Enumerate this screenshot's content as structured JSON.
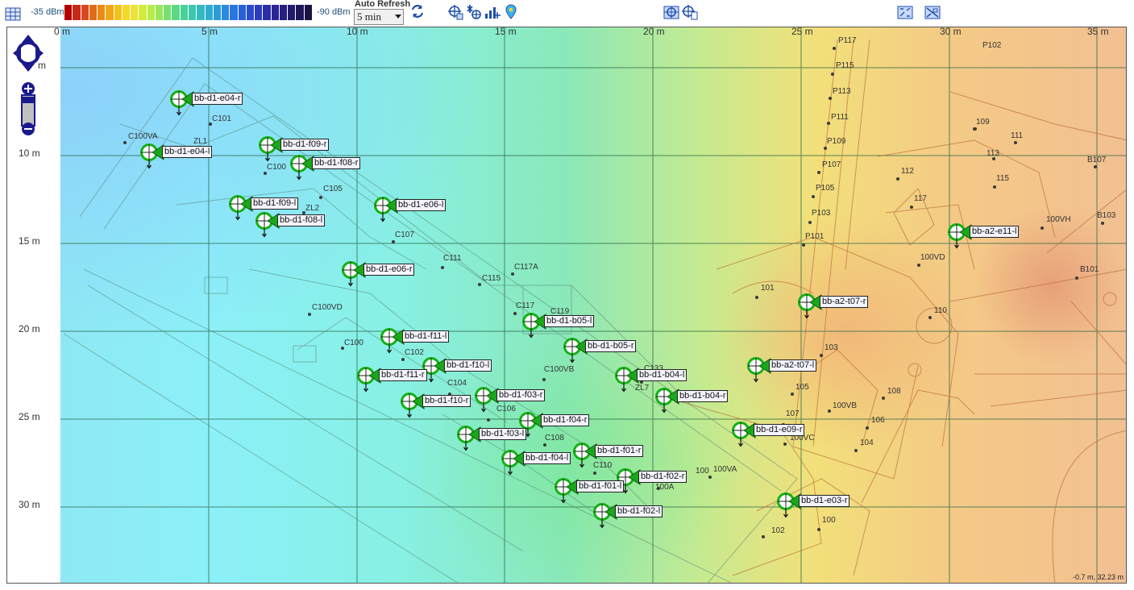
{
  "toolbar": {
    "legend_min": "-35 dBm",
    "legend_max": "-90 dBm",
    "legend_colors": [
      "#b40000",
      "#c8281a",
      "#d9481c",
      "#e26a18",
      "#ea8a16",
      "#f0a818",
      "#f4c21c",
      "#f4d826",
      "#eae434",
      "#d4ea3c",
      "#b8ea48",
      "#98e65a",
      "#78e06e",
      "#5cd884",
      "#48d09a",
      "#3cc6ae",
      "#34bac0",
      "#30acce",
      "#2c9cd8",
      "#2a8ade",
      "#2876de",
      "#2860d8",
      "#2a4ccc",
      "#2c3cbc",
      "#2c2ea8",
      "#2a2494",
      "#261e80",
      "#221a6c",
      "#1e1658",
      "#1a1246"
    ],
    "auto_refresh_label": "Auto Refresh",
    "auto_refresh_value": "5 min",
    "icons": [
      "grid-icon",
      "refresh-icon",
      "locate-ap-icon",
      "sensor-icon",
      "signal-bars-icon",
      "map-pin-icon",
      "target-grid-icon",
      "target-clipboard-icon",
      "zoom-fit-icon",
      "zoom-selection-icon"
    ]
  },
  "map": {
    "x_ticks": [
      "0 m",
      "5 m",
      "10 m",
      "15 m",
      "20 m",
      "25 m",
      "30 m",
      "35 m"
    ],
    "y_ticks": [
      "m",
      "10 m",
      "15 m",
      "20 m",
      "25 m",
      "30 m"
    ],
    "coords": "-0.7 m, 32.23 m",
    "access_points": [
      {
        "label": "bb-d1-e04-r"
      },
      {
        "label": "bb-d1-e04-l"
      },
      {
        "label": "bb-d1-f09-r"
      },
      {
        "label": "bb-d1-f08-r"
      },
      {
        "label": "bb-d1-f09-l"
      },
      {
        "label": "bb-d1-f08-l"
      },
      {
        "label": "bb-d1-e06-l"
      },
      {
        "label": "bb-d1-e06-r"
      },
      {
        "label": "bb-d1-b05-l"
      },
      {
        "label": "bb-d1-f11-l"
      },
      {
        "label": "bb-d1-b05-r"
      },
      {
        "label": "bb-d1-f10-l"
      },
      {
        "label": "bb-d1-f11-r"
      },
      {
        "label": "bb-d1-b04-l"
      },
      {
        "label": "bb-d1-f03-r"
      },
      {
        "label": "bb-d1-f10-r"
      },
      {
        "label": "bb-d1-b04-r"
      },
      {
        "label": "bb-d1-f04-r"
      },
      {
        "label": "bb-d1-f03-l"
      },
      {
        "label": "bb-d1-f01-r"
      },
      {
        "label": "bb-d1-f04-l"
      },
      {
        "label": "bb-d1-f02-r"
      },
      {
        "label": "bb-d1-f01-l"
      },
      {
        "label": "bb-d1-f02-l"
      },
      {
        "label": "bb-a2-e11-l"
      },
      {
        "label": "bb-a2-t07-r"
      },
      {
        "label": "bb-a2-t07-l"
      },
      {
        "label": "bb-d1-e09-r"
      },
      {
        "label": "bb-d1-e03-r"
      }
    ],
    "rooms": [
      "C101",
      "C100VA",
      "ZL1",
      "C100",
      "C105",
      "ZL2",
      "C107",
      "C111",
      "C115",
      "C117A",
      "C100VD",
      "C117",
      "C119",
      "C100",
      "C102",
      "C100VB",
      "C133",
      "ZL7",
      "C104",
      "C106",
      "C108",
      "C110",
      "100A",
      "100",
      "100VA",
      "P117",
      "P115",
      "P113",
      "P111",
      "P109",
      "P107",
      "P105",
      "P103",
      "P101",
      "P102",
      "109",
      "111",
      "113",
      "115",
      "112",
      "117",
      "100VH",
      "B107",
      "B103",
      "100VD",
      "B101",
      "101",
      "110",
      "103",
      "105",
      "100VB",
      "108",
      "107",
      "106",
      "100VC",
      "104",
      "102",
      "100",
      "102"
    ]
  }
}
